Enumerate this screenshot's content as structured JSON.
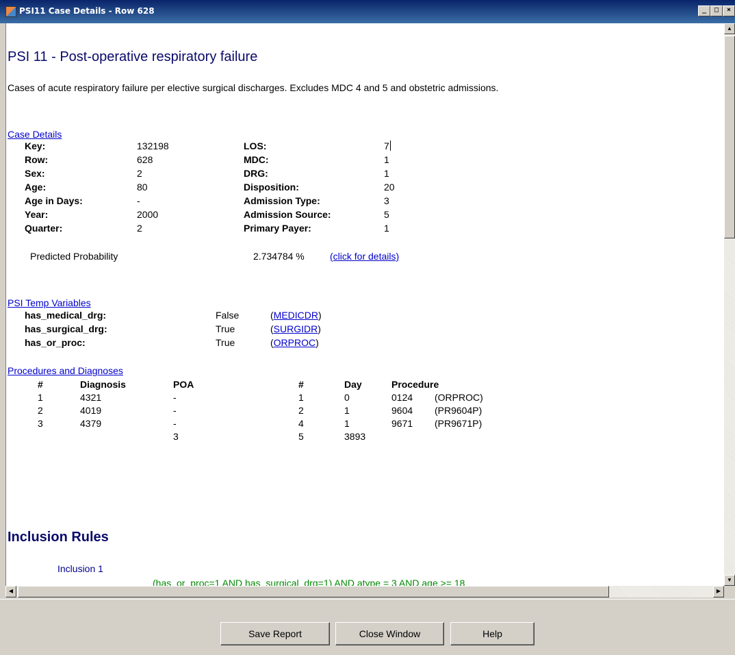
{
  "window": {
    "title": "PSI11 Case Details - Row 628",
    "controls": [
      "minimize",
      "maximize",
      "close"
    ]
  },
  "report": {
    "heading": "PSI 11 - Post-operative respiratory failure",
    "description": "Cases of acute respiratory failure per elective surgical discharges. Excludes MDC 4 and 5 and obstetric admissions.",
    "case_details": {
      "section_title": "Case Details",
      "left": [
        {
          "label": "Key:",
          "value": "132198"
        },
        {
          "label": "Row:",
          "value": "628"
        },
        {
          "label": "Sex:",
          "value": "2"
        },
        {
          "label": "Age:",
          "value": "80"
        },
        {
          "label": "Age in Days:",
          "value": "-"
        },
        {
          "label": "Year:",
          "value": "2000"
        },
        {
          "label": "Quarter:",
          "value": "2"
        }
      ],
      "right": [
        {
          "label": "LOS:",
          "value": "7"
        },
        {
          "label": "MDC:",
          "value": "1"
        },
        {
          "label": "DRG:",
          "value": "1"
        },
        {
          "label": "Disposition:",
          "value": "20"
        },
        {
          "label": "Admission Type:",
          "value": "3"
        },
        {
          "label": "Admission Source:",
          "value": "5"
        },
        {
          "label": "Primary Payer:",
          "value": "1"
        }
      ],
      "predicted_label": "Predicted Probability",
      "predicted_value": "2.734784 %",
      "details_link": "(click for details)"
    },
    "temp_vars": {
      "section_title": "PSI Temp Variables",
      "rows": [
        {
          "name": "has_medical_drg:",
          "value": "False",
          "open": "(",
          "link": "MEDICDR",
          "close": ")"
        },
        {
          "name": "has_surgical_drg:",
          "value": "True",
          "open": "(",
          "link": "SURGIDR",
          "close": ")"
        },
        {
          "name": "has_or_proc:",
          "value": "True",
          "open": "(",
          "link": "ORPROC",
          "close": ")"
        }
      ]
    },
    "procedures": {
      "section_title": "Procedures and Diagnoses",
      "diag_headers": [
        "#",
        "Diagnosis",
        "POA"
      ],
      "diag_rows": [
        [
          "1",
          "4321",
          "-"
        ],
        [
          "2",
          "4019",
          "-"
        ],
        [
          "3",
          "4379",
          "-"
        ],
        [
          "",
          "",
          "3"
        ]
      ],
      "proc_headers": [
        "#",
        "Day",
        "Procedure"
      ],
      "proc_rows": [
        [
          "1",
          "0",
          "0124",
          "(ORPROC)"
        ],
        [
          "2",
          "1",
          "9604",
          "(PR9604P)"
        ],
        [
          "4",
          "1",
          "9671",
          "(PR9671P)"
        ],
        [
          "5",
          "3893",
          "",
          ""
        ]
      ]
    },
    "inclusion": {
      "heading": "Inclusion Rules",
      "item": "Inclusion 1",
      "rule": "(has_or_proc=1 AND has_surgical_drg=1) AND atype = 3 AND age >= 18"
    }
  },
  "buttons": {
    "save": "Save Report",
    "close": "Close Window",
    "help": "Help"
  }
}
